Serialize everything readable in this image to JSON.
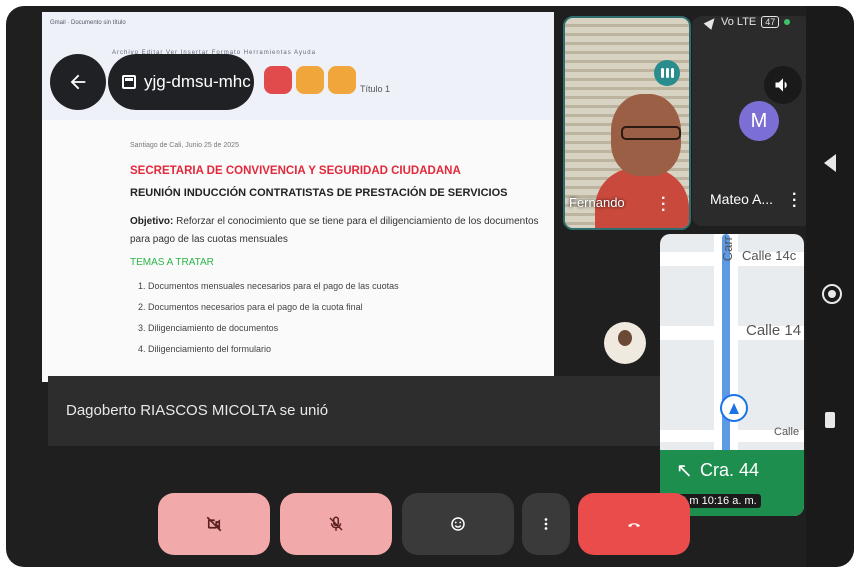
{
  "status": {
    "signal": "Vo LTE",
    "battery": "47"
  },
  "meeting": {
    "code": "yjg-dmsu-mhc"
  },
  "document": {
    "browser_tabs": "Gmail · Documento sin título",
    "menu": "Archivo  Editar  Ver  Insertar  Formato  Herramientas  Ayuda",
    "title": "Título 1",
    "date": "Santiago de Cali, Junio 25 de 2025",
    "heading": "SECRETARIA DE CONVIVENCIA Y SEGURIDAD CIUDADANA",
    "subheading": "REUNIÓN INDUCCIÓN CONTRATISTAS DE PRESTACIÓN DE SERVICIOS",
    "objective_label": "Objetivo:",
    "objective_text": "Reforzar el conocimiento que se tiene para el diligenciamiento de los documentos para pago de las cuotas mensuales",
    "topics_heading": "TEMAS A TRATAR",
    "topics": [
      "1. Documentos mensuales necesarios para el pago de las cuotas",
      "2. Documentos necesarios para el pago de la cuota final",
      "3. Diligenciamiento de documentos",
      "4. Diligenciamiento del formulario"
    ]
  },
  "participants": [
    {
      "name": "Fernando"
    },
    {
      "name": "Mateo A...",
      "initial": "M"
    }
  ],
  "toast": "Dagoberto RIASCOS MICOLTA se unió",
  "map": {
    "street_top": "Calle 14c",
    "street_mid": "Calle 14",
    "street_vertical": "Carr",
    "street_bottom": "Calle",
    "next_street": "Cra. 44",
    "distance_time": "140 m  10:16 a. m.",
    "direction_glyph": "↖"
  },
  "colors": {
    "end_call": "#ea4b4b",
    "muted_btn": "#f2a9a9",
    "nav_green": "#1e8e4e",
    "accent_teal": "#2a8c8c"
  }
}
